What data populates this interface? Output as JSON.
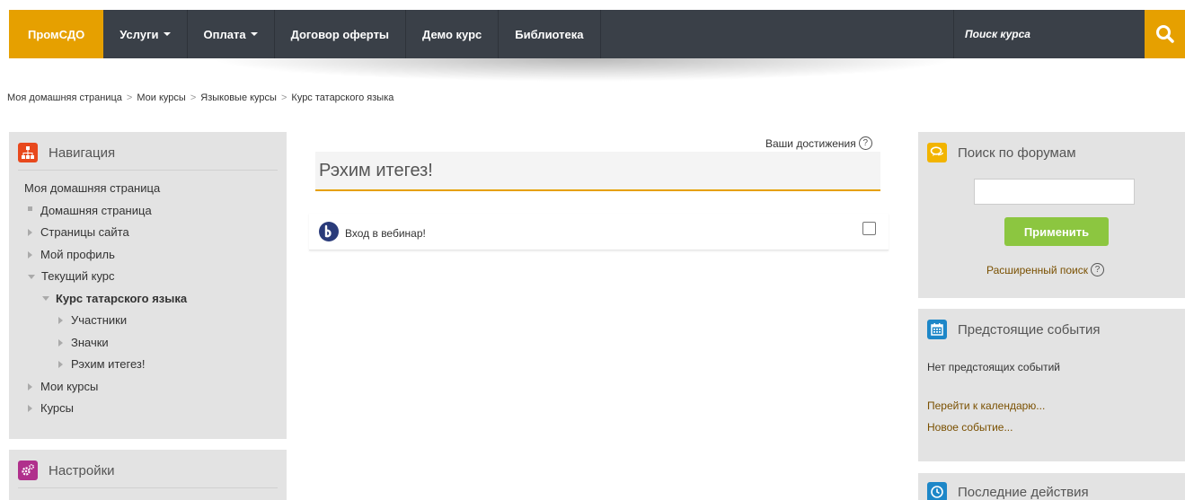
{
  "navbar": {
    "brand": "ПромСДО",
    "items": [
      {
        "label": "Услуги",
        "dropdown": true
      },
      {
        "label": "Оплата",
        "dropdown": true
      },
      {
        "label": "Договор оферты"
      },
      {
        "label": "Демо курс"
      },
      {
        "label": "Библиотека"
      }
    ],
    "search_placeholder": "Поиск курса",
    "search_icon": "search-icon"
  },
  "breadcrumb": [
    "Моя домашняя страница",
    "Мои курсы",
    "Языковые курсы",
    "Курс татарского языка"
  ],
  "navigation": {
    "title": "Навигация",
    "icon": "sitemap-icon",
    "items": [
      {
        "label": "Моя домашняя страница"
      },
      {
        "label": "Домашняя страница"
      },
      {
        "label": "Страницы сайта"
      },
      {
        "label": "Мой профиль"
      },
      {
        "label": "Текущий курс"
      },
      {
        "label": "Курс татарского языка"
      },
      {
        "label": "Участники"
      },
      {
        "label": "Значки"
      },
      {
        "label": "Рэхим итегез!"
      },
      {
        "label": "Мои курсы"
      },
      {
        "label": "Курсы"
      }
    ]
  },
  "settings": {
    "title": "Настройки",
    "icon": "gears-icon"
  },
  "main": {
    "achievements": "Ваши достижения",
    "section_title": "Рэхим итегез!",
    "activity": {
      "label": "Вход в вебинар!",
      "icon": "bigbluebutton-icon"
    }
  },
  "forum_search": {
    "title": "Поиск по форумам",
    "icon": "chat-icon",
    "input_value": "",
    "apply_label": "Применить",
    "advanced_label": "Расширенный поиск"
  },
  "upcoming": {
    "title": "Предстоящие события",
    "icon": "calendar-icon",
    "empty": "Нет предстоящих событий",
    "goto_calendar": "Перейти к календарю...",
    "new_event": "Новое событие..."
  },
  "recent": {
    "title": "Последние действия",
    "icon": "clock-icon"
  },
  "colors": {
    "accent": "#e6a000",
    "navbar": "#3a4048",
    "apply": "#8cc640"
  }
}
